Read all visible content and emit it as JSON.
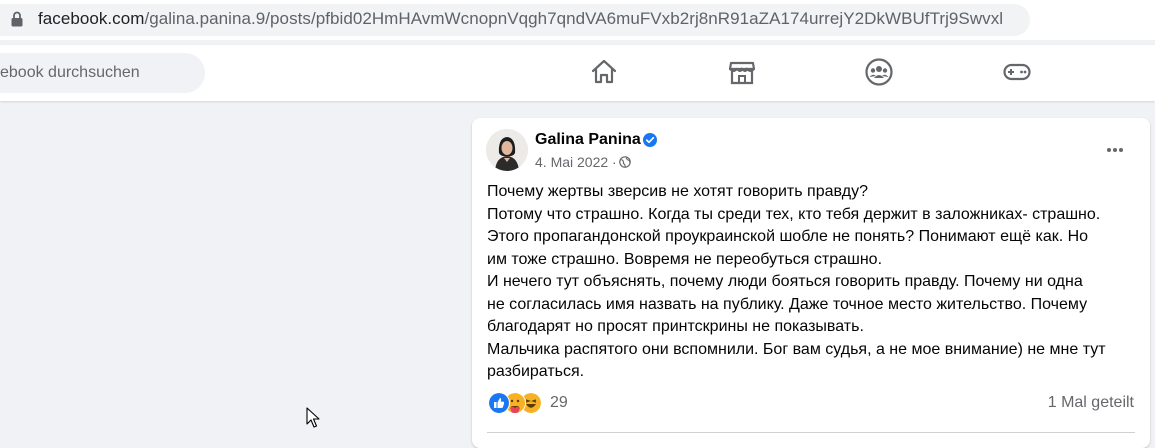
{
  "browser": {
    "url_domain": "facebook.com",
    "url_path": "/galina.panina.9/posts/pfbid02HmHAvmWcnopnVqgh7qndVA6muFVxb2rj8nR91aZA174urrejY2DkWBUfTrj9Swvxl"
  },
  "header": {
    "search_placeholder": "ebook durchsuchen",
    "nav_icons": [
      "home-icon",
      "marketplace-icon",
      "groups-icon",
      "gaming-icon"
    ]
  },
  "post": {
    "author": "Galina Panina",
    "date": "4. Mai 2022 ·",
    "paragraphs": [
      "Почему жертвы зверсив не хотят говорить правду?",
      "Потому что страшно. Когда ты среди тех, кто тебя держит в заложниках- страшно.",
      "Этого пропагандонской проукраинской шобле не понять? Понимают ещё как. Но",
      "им тоже страшно. Вовремя не переобуться страшно.",
      "И нечего тут объяснять, почему люди бояться говорить правду. Почему ни одна",
      "не согласилась имя назвать на публику. Даже точное место жительство. Почему",
      "благодарят но просят принтскрины не показывать.",
      "Мальчика распятого они вспомнили. Бог вам судья, а не мое внимание) не мне тут",
      "разбираться."
    ],
    "reaction_count": "29",
    "shares": "1 Mal geteilt"
  },
  "colors": {
    "accent": "#1877f2",
    "text": "#050505",
    "secondary_text": "#65676b",
    "background": "#f0f2f5"
  }
}
